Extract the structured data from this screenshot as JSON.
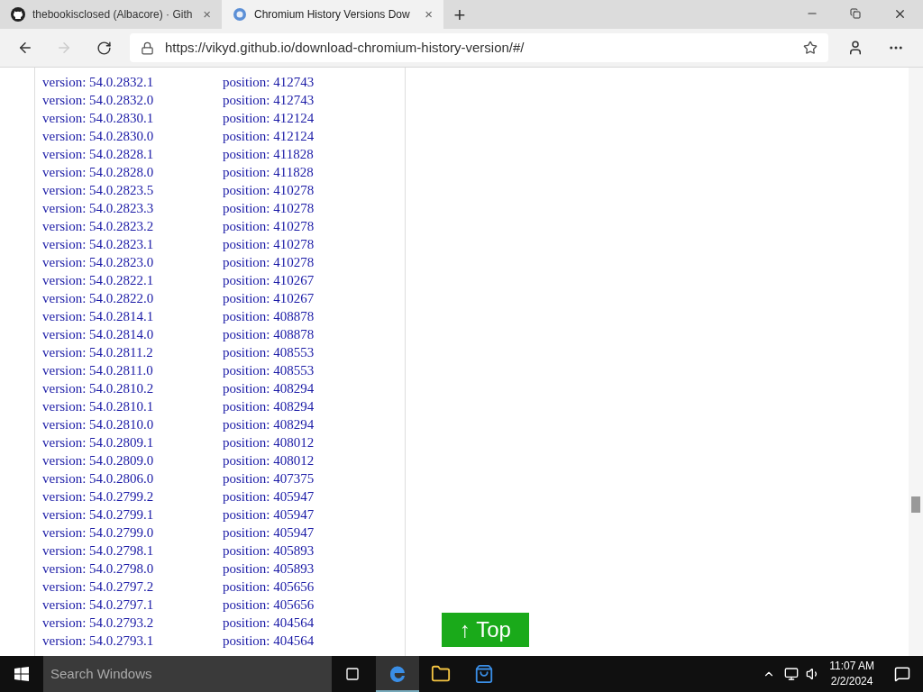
{
  "tabs": [
    {
      "title": "thebookisclosed (Albacore) · Gith",
      "close": "×",
      "selected": false
    },
    {
      "title": "Chromium History Versions Dow",
      "close": "×",
      "selected": true
    }
  ],
  "new_tab": "+",
  "address": "https://vikyd.github.io/download-chromium-history-version/#/",
  "rows": [
    {
      "version": "version: 54.0.2832.1",
      "position": "position: 412743"
    },
    {
      "version": "version: 54.0.2832.0",
      "position": "position: 412743"
    },
    {
      "version": "version: 54.0.2830.1",
      "position": "position: 412124"
    },
    {
      "version": "version: 54.0.2830.0",
      "position": "position: 412124"
    },
    {
      "version": "version: 54.0.2828.1",
      "position": "position: 411828"
    },
    {
      "version": "version: 54.0.2828.0",
      "position": "position: 411828"
    },
    {
      "version": "version: 54.0.2823.5",
      "position": "position: 410278"
    },
    {
      "version": "version: 54.0.2823.3",
      "position": "position: 410278"
    },
    {
      "version": "version: 54.0.2823.2",
      "position": "position: 410278"
    },
    {
      "version": "version: 54.0.2823.1",
      "position": "position: 410278"
    },
    {
      "version": "version: 54.0.2823.0",
      "position": "position: 410278"
    },
    {
      "version": "version: 54.0.2822.1",
      "position": "position: 410267"
    },
    {
      "version": "version: 54.0.2822.0",
      "position": "position: 410267"
    },
    {
      "version": "version: 54.0.2814.1",
      "position": "position: 408878"
    },
    {
      "version": "version: 54.0.2814.0",
      "position": "position: 408878"
    },
    {
      "version": "version: 54.0.2811.2",
      "position": "position: 408553"
    },
    {
      "version": "version: 54.0.2811.0",
      "position": "position: 408553"
    },
    {
      "version": "version: 54.0.2810.2",
      "position": "position: 408294"
    },
    {
      "version": "version: 54.0.2810.1",
      "position": "position: 408294"
    },
    {
      "version": "version: 54.0.2810.0",
      "position": "position: 408294"
    },
    {
      "version": "version: 54.0.2809.1",
      "position": "position: 408012"
    },
    {
      "version": "version: 54.0.2809.0",
      "position": "position: 408012"
    },
    {
      "version": "version: 54.0.2806.0",
      "position": "position: 407375"
    },
    {
      "version": "version: 54.0.2799.2",
      "position": "position: 405947"
    },
    {
      "version": "version: 54.0.2799.1",
      "position": "position: 405947"
    },
    {
      "version": "version: 54.0.2799.0",
      "position": "position: 405947"
    },
    {
      "version": "version: 54.0.2798.1",
      "position": "position: 405893"
    },
    {
      "version": "version: 54.0.2798.0",
      "position": "position: 405893"
    },
    {
      "version": "version: 54.0.2797.2",
      "position": "position: 405656"
    },
    {
      "version": "version: 54.0.2797.1",
      "position": "position: 405656"
    },
    {
      "version": "version: 54.0.2793.2",
      "position": "position: 404564"
    },
    {
      "version": "version: 54.0.2793.1",
      "position": "position: 404564"
    }
  ],
  "top_button": "↑ Top",
  "taskbar": {
    "search_placeholder": "Search Windows",
    "time": "11:07 AM",
    "date": "2/2/2024"
  }
}
